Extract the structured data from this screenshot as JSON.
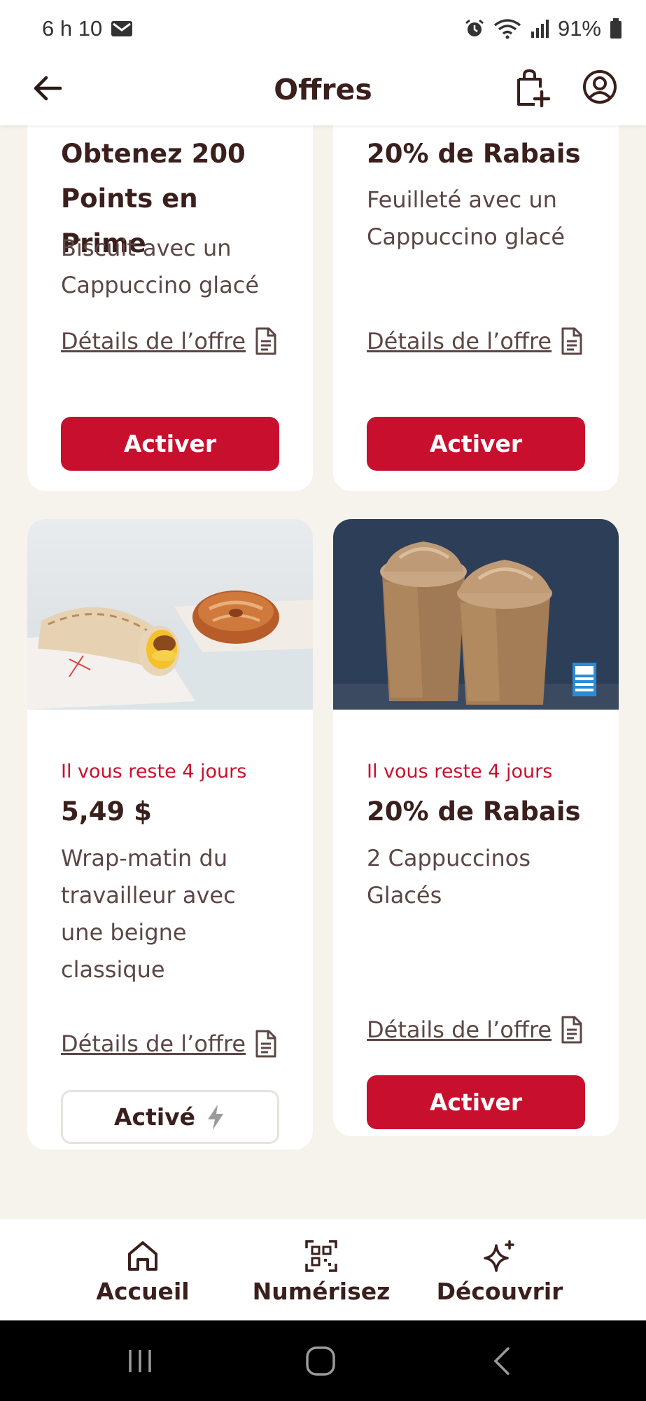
{
  "status_bar": {
    "time": "6 h 10",
    "battery": "91%"
  },
  "header": {
    "title": "Offres"
  },
  "cards": [
    {
      "headline": "Obtenez 200 Points en Prime",
      "description": "Biscuit avec un Cappuccino glacé",
      "details_label": "Détails de l’offre",
      "button_label": "Activer"
    },
    {
      "headline": "20% de Rabais",
      "description": "Feuilleté avec un Cappuccino glacé",
      "details_label": "Détails de l’offre",
      "button_label": "Activer"
    },
    {
      "expiry": "Il vous reste 4 jours",
      "headline": "5,49 $",
      "description": "Wrap-matin du travailleur avec une beigne classique",
      "details_label": "Détails de l’offre",
      "button_label": "Activé"
    },
    {
      "expiry": "Il vous reste 4 jours",
      "headline": "20% de Rabais",
      "description": "2 Cappuccinos Glacés",
      "details_label": "Détails de l’offre",
      "button_label": "Activer"
    }
  ],
  "bottom_nav": [
    {
      "label": "Accueil",
      "icon": "home-icon"
    },
    {
      "label": "Numérisez",
      "icon": "qr-scan-icon"
    },
    {
      "label": "Découvrir",
      "icon": "sparkle-icon"
    }
  ],
  "colors": {
    "brand_red": "#c8102e",
    "text_brown": "#3a1f1d",
    "page_bg": "#f6f2ec"
  }
}
